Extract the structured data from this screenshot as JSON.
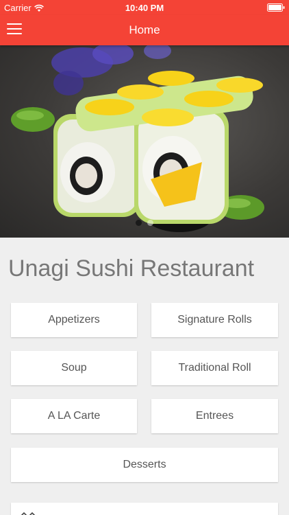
{
  "status_bar": {
    "carrier": "Carrier",
    "time": "10:40 PM",
    "wifi_icon": "wifi-icon",
    "battery_icon": "battery-icon"
  },
  "nav": {
    "title": "Home",
    "menu_icon": "hamburger-menu-icon"
  },
  "hero": {
    "image": "sushi rolls with lemon slices",
    "carousel": {
      "count": 2,
      "active": 0
    }
  },
  "restaurant": {
    "name": "Unagi Sushi Restaurant"
  },
  "menu": {
    "categories": [
      "Appetizers",
      "Signature Rolls",
      "Soup",
      "Traditional Roll",
      "A LA Carte",
      "Entrees",
      "Desserts"
    ]
  },
  "colors": {
    "accent": "#f44336",
    "background": "#efefef",
    "card": "#ffffff",
    "text": "#555555"
  }
}
